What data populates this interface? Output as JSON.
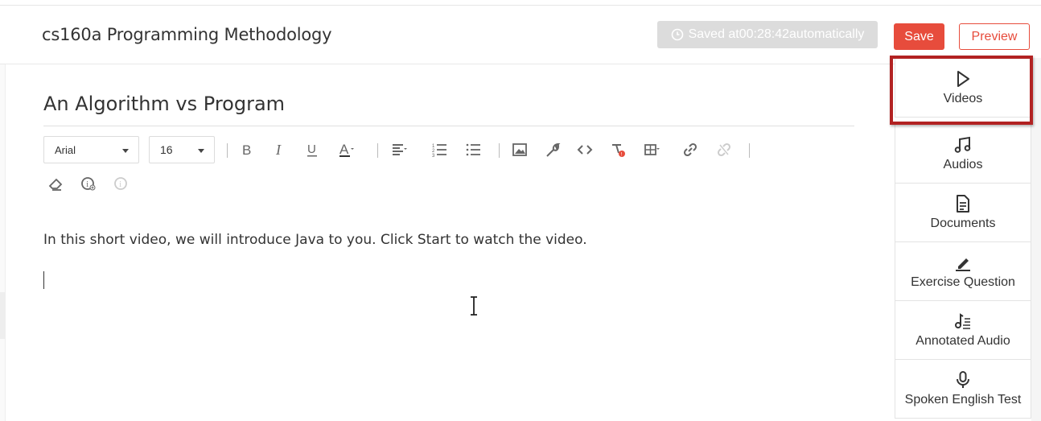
{
  "header": {
    "course_title": "cs160a Programming Methodology",
    "saved_status": "Saved at00:28:42automatically",
    "save_label": "Save",
    "preview_label": "Preview"
  },
  "editor": {
    "lesson_title": "An Algorithm vs Program",
    "font_family": "Arial",
    "font_size": "16",
    "body_text": "In this short video, we will introduce Java to you. Click Start to watch the video."
  },
  "toolbar_icons": [
    "bold-icon",
    "italic-icon",
    "underline-icon",
    "font-color-icon",
    "align-icon",
    "ordered-list-icon",
    "unordered-list-icon",
    "image-icon",
    "tool-icon",
    "code-icon",
    "clear-format-icon",
    "table-icon",
    "link-icon",
    "unlink-icon",
    "eraser-icon",
    "info-add-icon",
    "info-icon"
  ],
  "sidebar": {
    "items": [
      {
        "label": "Videos",
        "icon": "play-icon"
      },
      {
        "label": "Audios",
        "icon": "music-note-icon"
      },
      {
        "label": "Documents",
        "icon": "document-icon"
      },
      {
        "label": "Exercise Question",
        "icon": "pencil-icon"
      },
      {
        "label": "Annotated Audio",
        "icon": "annotated-audio-icon"
      },
      {
        "label": "Spoken English Test",
        "icon": "microphone-icon"
      }
    ]
  },
  "colors": {
    "accent": "#e74c3c",
    "highlight_border": "#b22222",
    "saved_bg": "#dcdcdc"
  }
}
